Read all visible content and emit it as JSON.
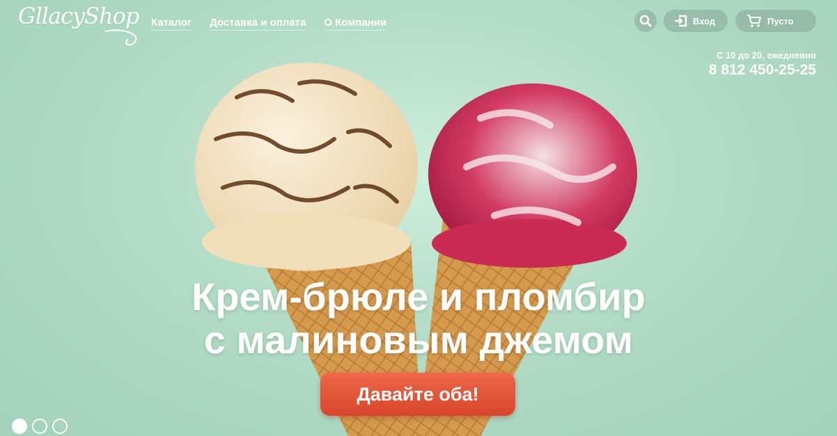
{
  "logo": {
    "text": "GllacyShop"
  },
  "nav": {
    "items": [
      {
        "label": "Каталог"
      },
      {
        "label": "Доставка и оплата"
      },
      {
        "label": "О Компании"
      }
    ]
  },
  "header": {
    "search_icon": "search-icon",
    "login": {
      "label": "Вход",
      "icon": "login-icon"
    },
    "cart": {
      "label": "Пусто",
      "icon": "cart-icon"
    }
  },
  "contacts": {
    "hours": "С 10 до 20, ежедневно",
    "phone": "8 812 450-25-25"
  },
  "hero": {
    "line1": "Крем-брюле и пломбир",
    "line2": "с малиновым джемом",
    "cta": "Давайте оба!",
    "slides": [
      {
        "active": true
      },
      {
        "active": false
      },
      {
        "active": false
      }
    ]
  },
  "colors": {
    "background": "#b2dcc6",
    "cta": "#e05a3a",
    "text": "#ffffff"
  }
}
